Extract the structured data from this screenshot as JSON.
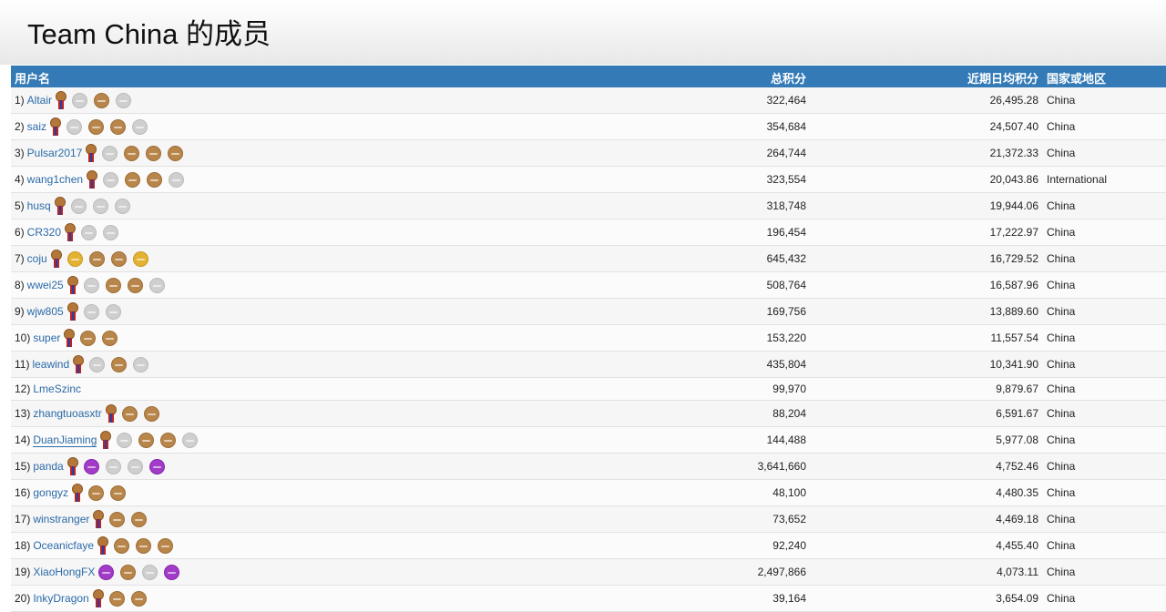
{
  "page": {
    "title": "Team China 的成员"
  },
  "table": {
    "headers": {
      "user": "用户名",
      "total": "总积分",
      "recent": "近期日均积分",
      "country": "国家或地区"
    },
    "rows": [
      {
        "rank": "1)",
        "name": "Altair",
        "badges": [
          "silver",
          "bronze",
          "silver"
        ],
        "total": "322,464",
        "recent": "26,495.28",
        "country": "China"
      },
      {
        "rank": "2)",
        "name": "saiz",
        "badges": [
          "silver",
          "bronze",
          "bronze",
          "silver"
        ],
        "total": "354,684",
        "recent": "24,507.40",
        "country": "China"
      },
      {
        "rank": "3)",
        "name": "Pulsar2017",
        "badges": [
          "silver",
          "bronze",
          "bronze",
          "bronze"
        ],
        "total": "264,744",
        "recent": "21,372.33",
        "country": "China"
      },
      {
        "rank": "4)",
        "name": "wang1chen",
        "badges": [
          "silver",
          "bronze",
          "bronze",
          "silver"
        ],
        "total": "323,554",
        "recent": "20,043.86",
        "country": "International"
      },
      {
        "rank": "5)",
        "name": "husq",
        "badges": [
          "silver",
          "silver",
          "silver"
        ],
        "total": "318,748",
        "recent": "19,944.06",
        "country": "China"
      },
      {
        "rank": "6)",
        "name": "CR320",
        "badges": [
          "silver",
          "silver"
        ],
        "total": "196,454",
        "recent": "17,222.97",
        "country": "China"
      },
      {
        "rank": "7)",
        "name": "coju",
        "badges": [
          "gold",
          "bronze",
          "bronze",
          "gold"
        ],
        "total": "645,432",
        "recent": "16,729.52",
        "country": "China"
      },
      {
        "rank": "8)",
        "name": "wwei25",
        "badges": [
          "silver",
          "bronze",
          "bronze",
          "silver"
        ],
        "total": "508,764",
        "recent": "16,587.96",
        "country": "China"
      },
      {
        "rank": "9)",
        "name": "wjw805",
        "badges": [
          "silver",
          "silver"
        ],
        "total": "169,756",
        "recent": "13,889.60",
        "country": "China"
      },
      {
        "rank": "10)",
        "name": "super",
        "badges": [
          "bronze",
          "bronze"
        ],
        "total": "153,220",
        "recent": "11,557.54",
        "country": "China"
      },
      {
        "rank": "11)",
        "name": "leawind",
        "badges": [
          "silver",
          "bronze",
          "silver"
        ],
        "total": "435,804",
        "recent": "10,341.90",
        "country": "China"
      },
      {
        "rank": "12)",
        "name": "LmeSzinc",
        "badges": [],
        "noribbon": true,
        "total": "99,970",
        "recent": "9,879.67",
        "country": "China"
      },
      {
        "rank": "13)",
        "name": "zhangtuoasxtr",
        "badges": [
          "bronze",
          "bronze"
        ],
        "total": "88,204",
        "recent": "6,591.67",
        "country": "China"
      },
      {
        "rank": "14)",
        "name": "DuanJiaming",
        "badges": [
          "silver",
          "bronze",
          "bronze",
          "silver"
        ],
        "total": "144,488",
        "recent": "5,977.08",
        "country": "China"
      },
      {
        "rank": "15)",
        "name": "panda",
        "badges": [
          "purple",
          "silver",
          "silver",
          "purple"
        ],
        "total": "3,641,660",
        "recent": "4,752.46",
        "country": "China"
      },
      {
        "rank": "16)",
        "name": "gongyz",
        "badges": [
          "bronze",
          "bronze"
        ],
        "total": "48,100",
        "recent": "4,480.35",
        "country": "China"
      },
      {
        "rank": "17)",
        "name": "winstranger",
        "badges": [
          "bronze",
          "bronze"
        ],
        "total": "73,652",
        "recent": "4,469.18",
        "country": "China"
      },
      {
        "rank": "18)",
        "name": "Oceanicfaye",
        "badges": [
          "bronze",
          "bronze",
          "bronze"
        ],
        "total": "92,240",
        "recent": "4,455.40",
        "country": "China"
      },
      {
        "rank": "19)",
        "name": "XiaoHongFX",
        "badges": [
          "purple",
          "bronze",
          "silver",
          "purple"
        ],
        "noribbon": true,
        "total": "2,497,866",
        "recent": "4,073.11",
        "country": "China"
      },
      {
        "rank": "20)",
        "name": "InkyDragon",
        "badges": [
          "bronze",
          "bronze"
        ],
        "total": "39,164",
        "recent": "3,654.09",
        "country": "China"
      }
    ]
  },
  "colors": {
    "header_bg": "#337ab7",
    "link": "#2a6aa8",
    "bronze": "#b8864a",
    "silver": "#cfcfcf",
    "gold": "#e3b233",
    "purple": "#a33bc9"
  }
}
